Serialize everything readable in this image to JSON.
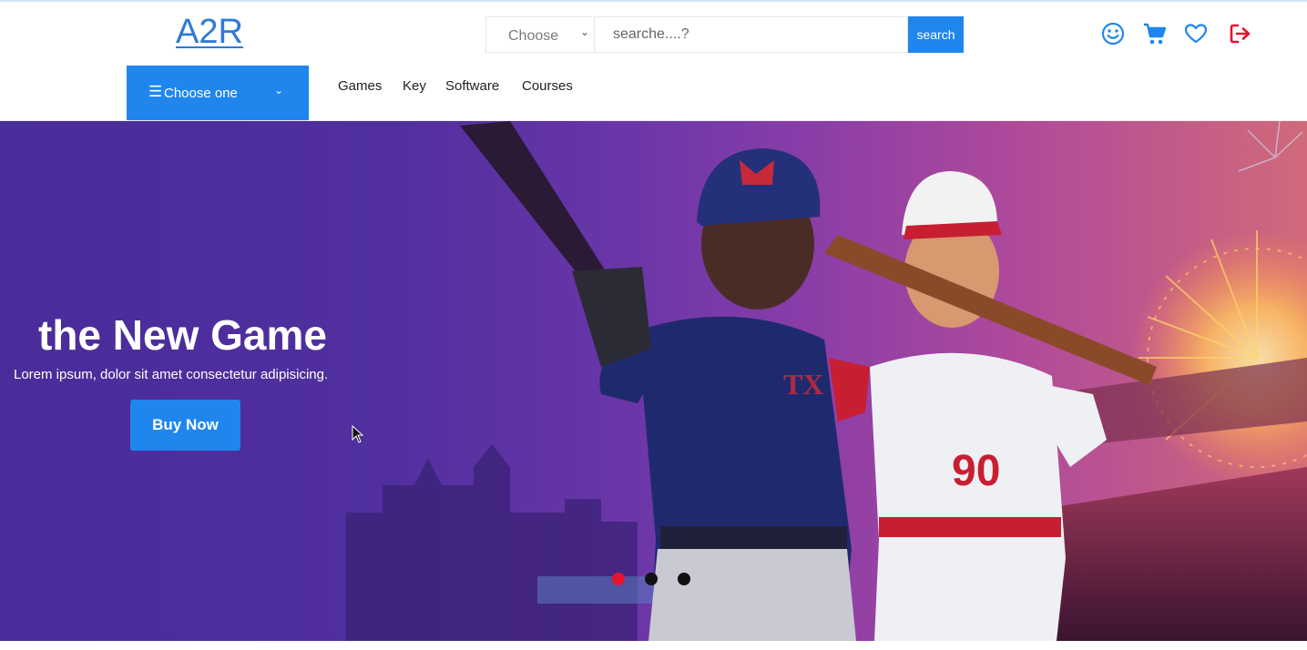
{
  "brand": {
    "logo": "A2R",
    "accent": "#1f86ee",
    "logo_color": "#2f7ad6"
  },
  "search": {
    "category_value": "Choose",
    "placeholder": "searche....?",
    "button_label": "search"
  },
  "header_icons": [
    "smiley-icon",
    "cart-icon",
    "heart-icon",
    "logout-icon"
  ],
  "nav": {
    "category_button": "Choose one",
    "links": [
      "Games",
      "Key",
      "Software",
      "Courses"
    ]
  },
  "hero": {
    "title": "the New Game",
    "subtitle": "Lorem ipsum, dolor sit amet consectetur adipisicing.",
    "cta": "Buy Now",
    "slides_count": 3,
    "active_slide": 1,
    "active_dot_color": "#e8132f"
  }
}
